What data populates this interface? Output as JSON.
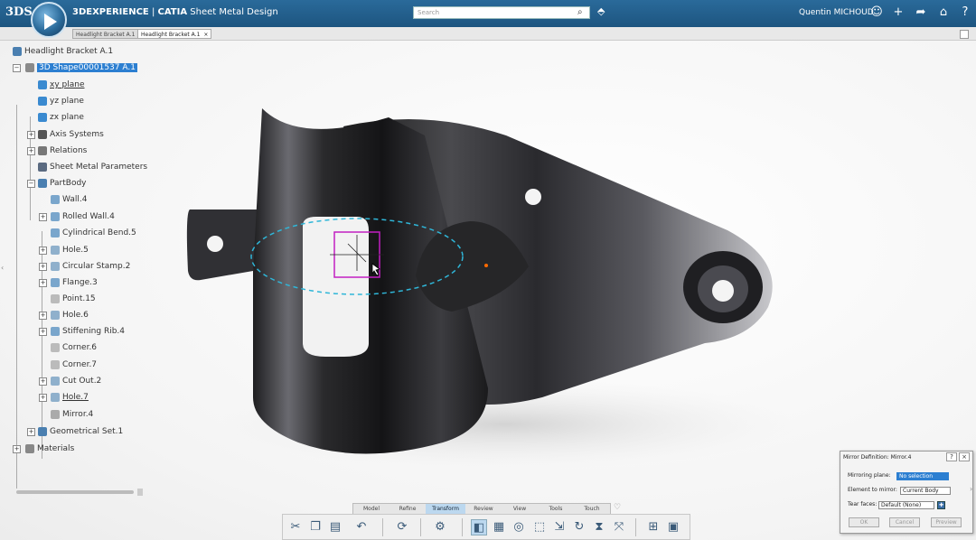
{
  "app": {
    "brand": "3DEXPERIENCE",
    "product": "CATIA",
    "app_name": "Sheet Metal Design",
    "user": "Quentin MICHOUD"
  },
  "search": {
    "placeholder": "Search"
  },
  "tabs": [
    {
      "label": "Headlight Bracket A.1",
      "active": false
    },
    {
      "label": "Headlight Bracket A.1",
      "active": true
    }
  ],
  "tree": {
    "root": "Headlight Bracket A.1",
    "part": "3D Shape00001537 A.1",
    "items": [
      {
        "label": "xy plane"
      },
      {
        "label": "yz plane"
      },
      {
        "label": "zx plane"
      },
      {
        "label": "Axis Systems"
      },
      {
        "label": "Relations"
      },
      {
        "label": "Sheet Metal Parameters"
      },
      {
        "label": "PartBody"
      }
    ],
    "body_items": [
      {
        "label": "Wall.4"
      },
      {
        "label": "Rolled Wall.4"
      },
      {
        "label": "Cylindrical Bend.5"
      },
      {
        "label": "Hole.5"
      },
      {
        "label": "Circular Stamp.2"
      },
      {
        "label": "Flange.3"
      },
      {
        "label": "Point.15"
      },
      {
        "label": "Hole.6"
      },
      {
        "label": "Stiffening Rib.4"
      },
      {
        "label": "Corner.6"
      },
      {
        "label": "Corner.7"
      },
      {
        "label": "Cut Out.2"
      },
      {
        "label": "Hole.7"
      },
      {
        "label": "Mirror.4"
      }
    ],
    "geo_set": "Geometrical Set.1",
    "materials": "Materials"
  },
  "section_tabs": [
    {
      "label": "Model",
      "active": false
    },
    {
      "label": "Refine",
      "active": false
    },
    {
      "label": "Transform",
      "active": true
    },
    {
      "label": "Review",
      "active": false
    },
    {
      "label": "View",
      "active": false
    },
    {
      "label": "Tools",
      "active": false
    },
    {
      "label": "Touch",
      "active": false
    }
  ],
  "dialog": {
    "title": "Mirror Definition: Mirror.4",
    "help": "?",
    "close": "×",
    "mirroring_plane_label": "Mirroring plane:",
    "mirroring_plane_value": "No selection",
    "element_label": "Element to mirror:",
    "element_value": "Current Body",
    "tear_faces_label": "Tear faces:",
    "tear_faces_value": "Default (None)",
    "ok": "OK",
    "cancel": "Cancel",
    "preview": "Preview"
  },
  "colors": {
    "accent": "#2c7fd1",
    "topbar": "#1d5580",
    "preview_ellipse": "#2fb6d8",
    "selection_box": "#c21fc2"
  }
}
